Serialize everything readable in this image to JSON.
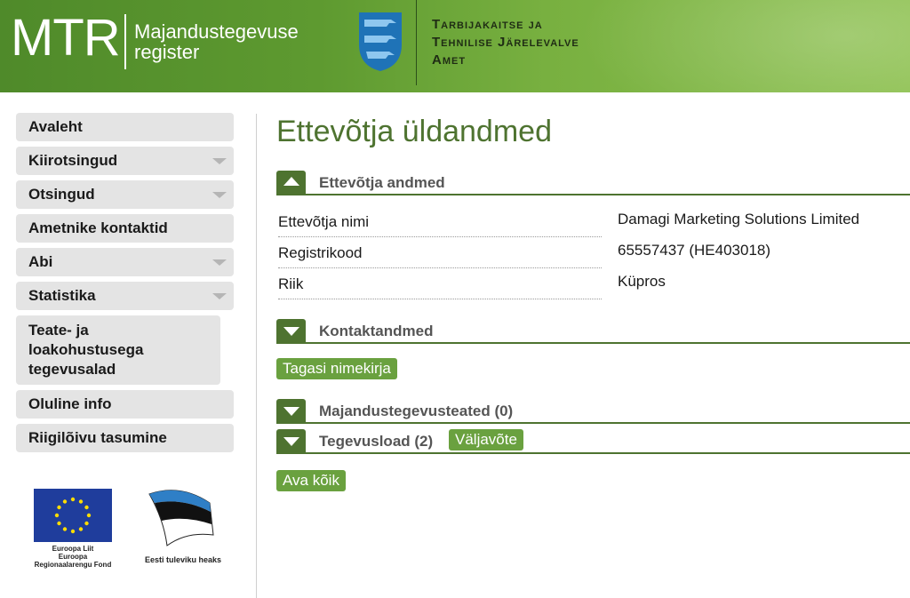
{
  "header": {
    "logo": "MTR",
    "subtitle_line1": "Majandustegevuse",
    "subtitle_line2": "register",
    "agency_line1": "Tarbijakaitse ja",
    "agency_line2": "Tehnilise Järelevalve",
    "agency_line3": "Amet"
  },
  "sidebar": {
    "items": [
      {
        "label": "Avaleht"
      },
      {
        "label": "Kiirotsingud"
      },
      {
        "label": "Otsingud"
      },
      {
        "label": "Ametnike kontaktid"
      },
      {
        "label": "Abi"
      },
      {
        "label": "Statistika"
      },
      {
        "label": "Teate- ja loakohustusega tegevusalad"
      },
      {
        "label": "Oluline info"
      },
      {
        "label": "Riigilõivu tasumine"
      }
    ],
    "eu_caption_1": "Euroopa Liit",
    "eu_caption_2": "Euroopa",
    "eu_caption_3": "Regionaalarengu Fond",
    "ee_caption": "Eesti tuleviku heaks"
  },
  "main": {
    "title": "Ettevõtja üldandmed",
    "section_company": "Ettevõtja andmed",
    "fields": [
      {
        "label": "Ettevõtja nimi",
        "value": "Damagi Marketing Solutions Limited"
      },
      {
        "label": "Registrikood",
        "value": "65557437 (HE403018)"
      },
      {
        "label": "Riik",
        "value": "Küpros"
      }
    ],
    "section_contact": "Kontaktandmed",
    "back_button": "Tagasi nimekirja",
    "section_notices": "Majandustegevusteated (0)",
    "section_licenses": "Tegevusload (2)",
    "extract_button": "Väljavõte",
    "open_all_button": "Ava kõik"
  },
  "colors": {
    "brand_green": "#4e7330",
    "button_green": "#6aa13f",
    "nav_bg": "#e4e4e4"
  }
}
